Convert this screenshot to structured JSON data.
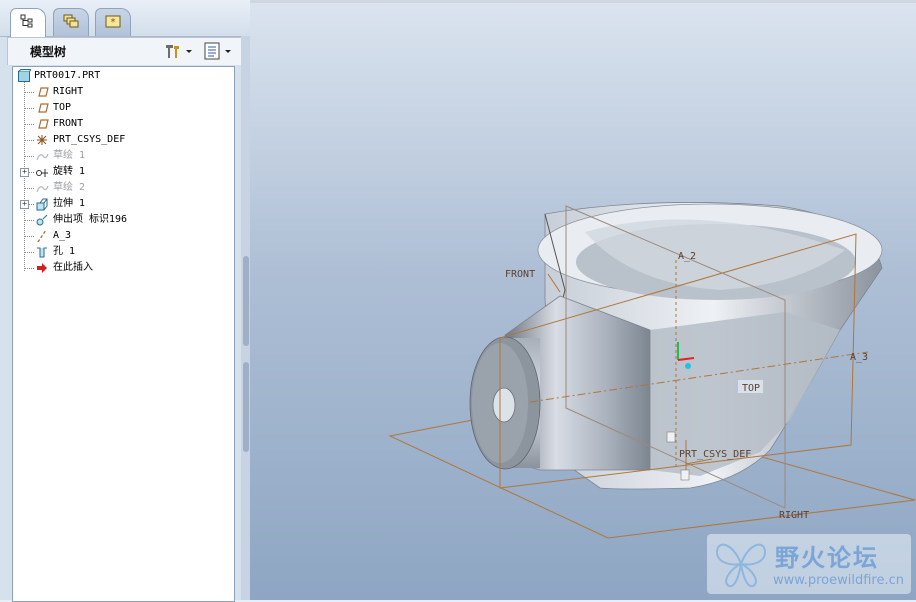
{
  "tabs": [
    "model-tree",
    "layers",
    "favorites"
  ],
  "panel": {
    "title": "模型树"
  },
  "tree": {
    "root": "PRT0017.PRT",
    "items": [
      {
        "label": "RIGHT",
        "icon": "datum-plane-icon",
        "grey": false,
        "expand": false
      },
      {
        "label": "TOP",
        "icon": "datum-plane-icon",
        "grey": false,
        "expand": false
      },
      {
        "label": "FRONT",
        "icon": "datum-plane-icon",
        "grey": false,
        "expand": false
      },
      {
        "label": "PRT_CSYS_DEF",
        "icon": "csys-icon",
        "grey": false,
        "expand": false
      },
      {
        "label": "草绘 1",
        "icon": "sketch-icon",
        "grey": true,
        "expand": false
      },
      {
        "label": "旋转 1",
        "icon": "revolve-icon",
        "grey": false,
        "expand": true
      },
      {
        "label": "草绘 2",
        "icon": "sketch-icon",
        "grey": true,
        "expand": false
      },
      {
        "label": "拉伸 1",
        "icon": "extrude-icon",
        "grey": false,
        "expand": true
      },
      {
        "label": "伸出项 标识196",
        "icon": "protrusion-icon",
        "grey": false,
        "expand": false
      },
      {
        "label": "A_3",
        "icon": "axis-icon",
        "grey": false,
        "expand": false
      },
      {
        "label": "孔 1",
        "icon": "hole-icon",
        "grey": false,
        "expand": false
      },
      {
        "label": "在此插入",
        "icon": "insert-here-icon",
        "grey": false,
        "expand": false
      }
    ]
  },
  "viewport": {
    "datum_labels": {
      "front": "FRONT",
      "a2": "A_2",
      "a3": "A_3",
      "top": "TOP",
      "csys": "PRT_CSYS_DEF",
      "right": "RIGHT"
    }
  },
  "watermark": {
    "name": "野火论坛",
    "url": "www.proewildfire.cn"
  },
  "colors": {
    "datum": "#b0763a",
    "part_light": "#dfe4ec",
    "part_dark": "#7f8690",
    "background_top": "#dbe4ef",
    "background_bottom": "#8ea6c3"
  }
}
